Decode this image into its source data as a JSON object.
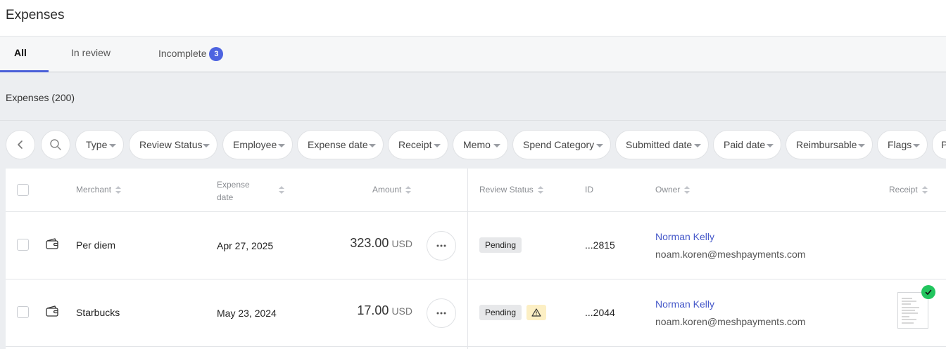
{
  "header": {
    "title": "Expenses"
  },
  "tabs": [
    {
      "label": "All"
    },
    {
      "label": "In review"
    },
    {
      "label": "Incomplete",
      "badge": "3"
    }
  ],
  "section": {
    "title": "Expenses (200)"
  },
  "filters": [
    "Type",
    "Review Status",
    "Employee",
    "Expense date",
    "Receipt",
    "Memo",
    "Spend Category",
    "Submitted date",
    "Paid date",
    "Reimbursable",
    "Flags",
    "P"
  ],
  "columns": {
    "merchant": "Merchant",
    "expense_date_1": "Expense",
    "expense_date_2": "date",
    "amount": "Amount",
    "review_status": "Review Status",
    "id": "ID",
    "owner": "Owner",
    "receipt": "Receipt"
  },
  "rows": [
    {
      "merchant": "Per diem",
      "date": "Apr 27, 2025",
      "amount": "323.00",
      "currency": "USD",
      "status": "Pending",
      "warning": false,
      "id": "...2815",
      "owner_name": "Norman Kelly",
      "owner_email": "noam.koren@meshpayments.com",
      "has_receipt": false
    },
    {
      "merchant": "Starbucks",
      "date": "May 23, 2024",
      "amount": "17.00",
      "currency": "USD",
      "status": "Pending",
      "warning": true,
      "id": "...2044",
      "owner_name": "Norman Kelly",
      "owner_email": "noam.koren@meshpayments.com",
      "has_receipt": true
    }
  ],
  "colors": {
    "accent": "#4a5fd8",
    "badge": "#4d63e0",
    "link": "#4558c9",
    "receipt_ok": "#22c55e",
    "warning_bg": "#fcefc4"
  },
  "icons": {
    "back": "chevron-left-icon",
    "search": "search-icon",
    "more": "more-horizontal-icon",
    "wallet": "wallet-icon",
    "warning": "warning-icon",
    "receipt": "receipt-thumbnail",
    "verified": "check-circle-icon"
  }
}
